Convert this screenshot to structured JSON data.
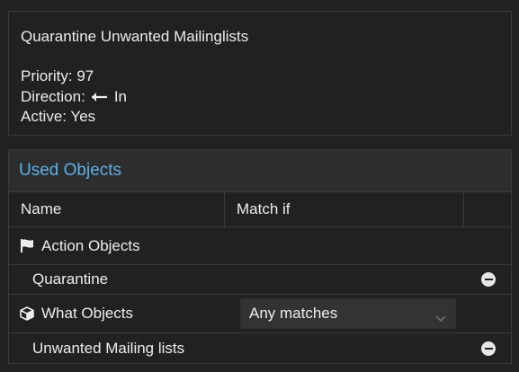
{
  "rule": {
    "title": "Quarantine Unwanted Mailinglists",
    "priority_label": "Priority: 97",
    "direction_label": "Direction:",
    "direction_value": "In",
    "direction_icon": "arrow-left-icon",
    "active_label": "Active: Yes"
  },
  "used_objects": {
    "title": "Used Objects",
    "columns": {
      "name": "Name",
      "match_if": "Match if"
    },
    "groups": [
      {
        "label": "Action Objects",
        "icon": "flag-icon",
        "items": [
          "Quarantine"
        ]
      },
      {
        "label": "What Objects",
        "icon": "cube-icon",
        "match_select": "Any matches",
        "items": [
          "Unwanted Mailing lists"
        ]
      }
    ]
  },
  "colors": {
    "accent": "#5ab0e8",
    "background": "#212121",
    "header": "#2d2d2d",
    "select": "#333333"
  }
}
